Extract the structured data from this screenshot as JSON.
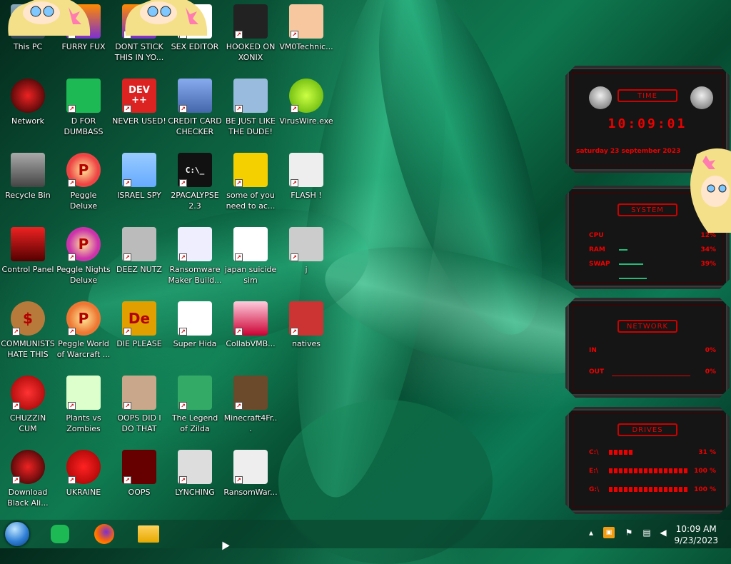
{
  "desktop_icons": [
    {
      "label": "This PC"
    },
    {
      "label": "FURRY FUX"
    },
    {
      "label": "DONT STICK THIS IN YO..."
    },
    {
      "label": "SEX EDITOR"
    },
    {
      "label": "HOOKED ON XONIX"
    },
    {
      "label": "VM0Technic..."
    },
    {
      "label": "Network"
    },
    {
      "label": "D FOR DUMBASS"
    },
    {
      "label": "NEVER USED!"
    },
    {
      "label": "CREDIT CARD CHECKER"
    },
    {
      "label": "BE JUST LIKE THE DUDE!"
    },
    {
      "label": "VirusWire.exe"
    },
    {
      "label": "Recycle Bin"
    },
    {
      "label": "Peggle Deluxe"
    },
    {
      "label": "ISRAEL SPY"
    },
    {
      "label": "2PACALYPSE 2.3"
    },
    {
      "label": "some of you need to ac..."
    },
    {
      "label": "FLASH !"
    },
    {
      "label": "Control Panel"
    },
    {
      "label": "Peggle Nights Deluxe"
    },
    {
      "label": "DEEZ NUTZ"
    },
    {
      "label": "Ransomware Maker Build..."
    },
    {
      "label": "japan suicide sim"
    },
    {
      "label": "j"
    },
    {
      "label": "COMMUNISTS HATE THIS G..."
    },
    {
      "label": "Peggle World of Warcraft ..."
    },
    {
      "label": "DIE PLEASE"
    },
    {
      "label": "Super Hida"
    },
    {
      "label": "CollabVMB..."
    },
    {
      "label": "natives"
    },
    {
      "label": "CHUZZIN CUM"
    },
    {
      "label": "Plants vs Zombies"
    },
    {
      "label": "OOPS DID I DO THAT"
    },
    {
      "label": "The Legend of Zilda"
    },
    {
      "label": "Minecraft4Fr..."
    },
    {
      "label": "Download Black Ali..."
    },
    {
      "label": "UKRAINE"
    },
    {
      "label": "OOPS"
    },
    {
      "label": "LYNCHING"
    },
    {
      "label": "RansomWar..."
    }
  ],
  "icon_art": {
    "dev": "DEV",
    "dev2": "++",
    "pkg": "P",
    "de": "De",
    "cmd": "C:\\_",
    "dollar": "$"
  },
  "widget": {
    "time_title": "TIME",
    "time": "10:09:01",
    "date": "saturday 23 september 2023",
    "system_title": "SYSTEM",
    "cpu_label": "CPU",
    "cpu_value": "12%",
    "cpu_pct": 12,
    "ram_label": "RAM",
    "ram_value": "34%",
    "ram_pct": 34,
    "swap_label": "SWAP",
    "swap_value": "39%",
    "swap_pct": 39,
    "network_title": "NETWORK",
    "in_label": "IN",
    "in_value": "0%",
    "out_label": "OUT",
    "out_value": "0%",
    "drives_title": "DRIVES",
    "drives": [
      {
        "label": "C:\\",
        "value": "31 %",
        "pct": 31
      },
      {
        "label": "E:\\",
        "value": "100 %",
        "pct": 100
      },
      {
        "label": "G:\\",
        "value": "100 %",
        "pct": 100
      }
    ]
  },
  "taskbar": {
    "clock_time": "10:09 AM",
    "clock_date": "9/23/2023"
  },
  "colors": {
    "accent_red": "#e00000",
    "panel_bg": "#151515",
    "taskbar_bg": "#0a3c28"
  }
}
